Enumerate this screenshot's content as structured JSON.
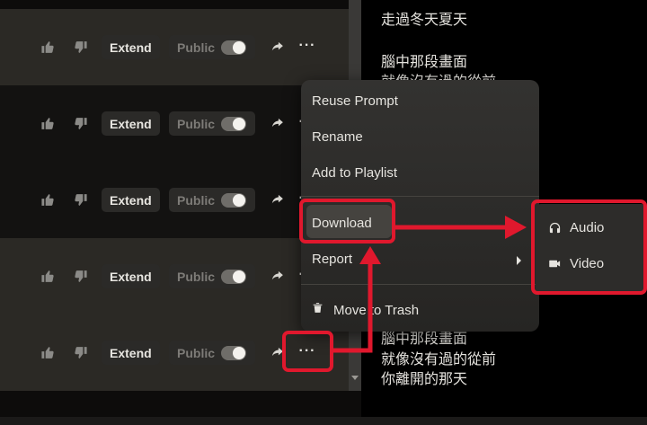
{
  "song_rows": [
    {
      "extend_label": "Extend",
      "public_label": "Public",
      "more_label": "···"
    },
    {
      "extend_label": "Extend",
      "public_label": "Public",
      "more_label": "···"
    },
    {
      "extend_label": "Extend",
      "public_label": "Public",
      "more_label": "···"
    },
    {
      "extend_label": "Extend",
      "public_label": "Public",
      "more_label": "···"
    },
    {
      "extend_label": "Extend",
      "public_label": "Public",
      "more_label": "···"
    }
  ],
  "lyrics": [
    "走過冬天夏天",
    "",
    "腦中那段畫面",
    "就像沒有過的從前",
    "腦中那段畫面",
    "就像沒有過的從前",
    "你離開的那天"
  ],
  "context_menu": {
    "items": [
      "Reuse Prompt",
      "Rename",
      "Add to Playlist",
      "Download",
      "Report",
      "Move to Trash"
    ]
  },
  "download_submenu": {
    "items": [
      "Audio",
      "Video"
    ]
  },
  "colors": {
    "annotation": "#e0182d",
    "menu_bg": "#2d2c2a"
  },
  "icons": [
    "thumbs-up-icon",
    "thumbs-down-icon",
    "share-icon",
    "trash-icon",
    "headphones-icon",
    "video-camera-icon",
    "chevron-right-icon"
  ]
}
